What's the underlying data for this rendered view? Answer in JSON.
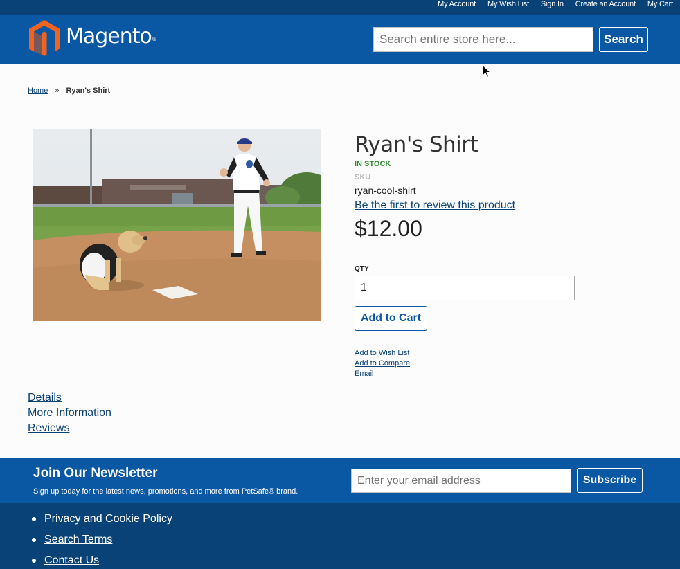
{
  "top_links": [
    "My Account",
    "My Wish List",
    "Sign In",
    "Create an Account",
    "My Cart"
  ],
  "header": {
    "logo_text": "Magento",
    "logo_mark": "®",
    "search_placeholder": "Search entire store here...",
    "search_button": "Search"
  },
  "breadcrumb": {
    "home": "Home",
    "separator": "»",
    "current": "Ryan's Shirt"
  },
  "product": {
    "title": "Ryan's Shirt",
    "stock": "IN STOCK",
    "sku_label": "SKU",
    "sku_value": "ryan-cool-shirt",
    "review_link": "Be the first to review this product",
    "price": "$12.00",
    "qty_label": "QTY",
    "qty_value": "1",
    "add_to_cart": "Add to Cart",
    "actions": [
      "Add to Wish List",
      "Add to Compare",
      "Email"
    ]
  },
  "tabs": [
    "Details",
    "More Information",
    "Reviews"
  ],
  "newsletter": {
    "title": "Join Our Newsletter",
    "subtitle": "Sign up today for the latest news, promotions, and more from PetSafe® brand.",
    "email_placeholder": "Enter your email address",
    "subscribe_button": "Subscribe"
  },
  "footer_links": [
    "Privacy and Cookie Policy",
    "Search Terms",
    "Contact Us"
  ],
  "colors": {
    "top_bar": "#094277",
    "header": "#0a57a4",
    "link": "#0a4176",
    "in_stock": "#2f8a2b",
    "logo_orange": "#f26322"
  }
}
